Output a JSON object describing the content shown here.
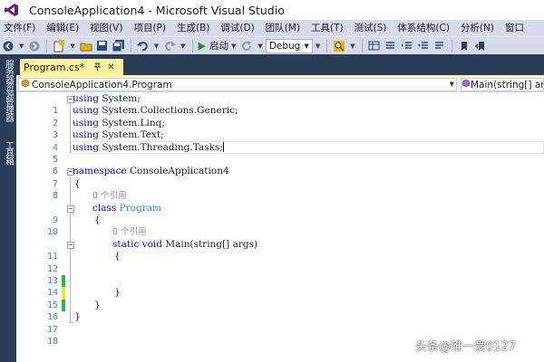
{
  "window": {
    "title": "ConsoleApplication4 - Microsoft Visual Studio"
  },
  "menu": {
    "items": [
      "文件(F)",
      "编辑(E)",
      "视图(V)",
      "项目(P)",
      "生成(B)",
      "调试(D)",
      "团队(M)",
      "工具(T)",
      "测试(S)",
      "体系结构(C)",
      "分析(N)",
      "窗口"
    ]
  },
  "toolbar": {
    "start_label": "启动",
    "config_value": "Debug"
  },
  "side_tabs": {
    "server_explorer": "服务器资源管理器",
    "toolbox": "工具箱"
  },
  "tab": {
    "label": "Program.cs*"
  },
  "nav": {
    "project": "ConsoleApplication4.Program",
    "member": "Main(string[] args)"
  },
  "editor": {
    "line_numbers": [
      "1",
      "2",
      "3",
      "4",
      "5",
      "6",
      "7",
      "8",
      "9",
      "10",
      "11",
      "12",
      "13",
      "14",
      "15",
      "16",
      "17",
      "18"
    ],
    "lines": [
      {
        "n": "1",
        "kw": "using",
        "rest": " System;"
      },
      {
        "n": "2",
        "kw": "using",
        "rest": " System.Collections.Generic;"
      },
      {
        "n": "3",
        "kw": "using",
        "rest": " System.Linq;"
      },
      {
        "n": "4",
        "kw": "using",
        "rest": " System.Text;"
      },
      {
        "n": "5",
        "kw": "using",
        "rest": " System.Threading.Tasks;"
      },
      {
        "n": "7",
        "kw": "namespace",
        "rest": " ConsoleApplication4"
      },
      {
        "n": "8",
        "text": "{"
      },
      {
        "n": "9",
        "kw": "class",
        "ty": "Program"
      },
      {
        "n": "10",
        "text": "{"
      },
      {
        "n": "11",
        "kw": "static void",
        "rest": " Main(string[] args)"
      },
      {
        "n": "12",
        "text": "{"
      },
      {
        "n": "15",
        "text": "}"
      },
      {
        "n": "16",
        "text": "}"
      },
      {
        "n": "17",
        "text": "}"
      }
    ],
    "class_refs": "0 个引用",
    "method_refs": "0 个引用"
  },
  "watermark": "头条@唯一爱0127",
  "colors": {
    "keyword": "#0000ff",
    "type": "#2b91af",
    "line_number": "#2b91af",
    "change_saved": "#2eb84c",
    "change_unsaved": "#f0e04a",
    "tab_active": "#fff29d",
    "chrome_dark": "#2b3c59",
    "chrome_light": "#d6dbe9"
  },
  "icons": [
    "visual-studio-logo",
    "back-icon",
    "forward-icon",
    "new-project-icon",
    "open-icon",
    "save-icon",
    "save-all-icon",
    "undo-icon",
    "redo-icon",
    "start-icon",
    "refresh-icon",
    "find-icon",
    "bookmark-icon"
  ]
}
